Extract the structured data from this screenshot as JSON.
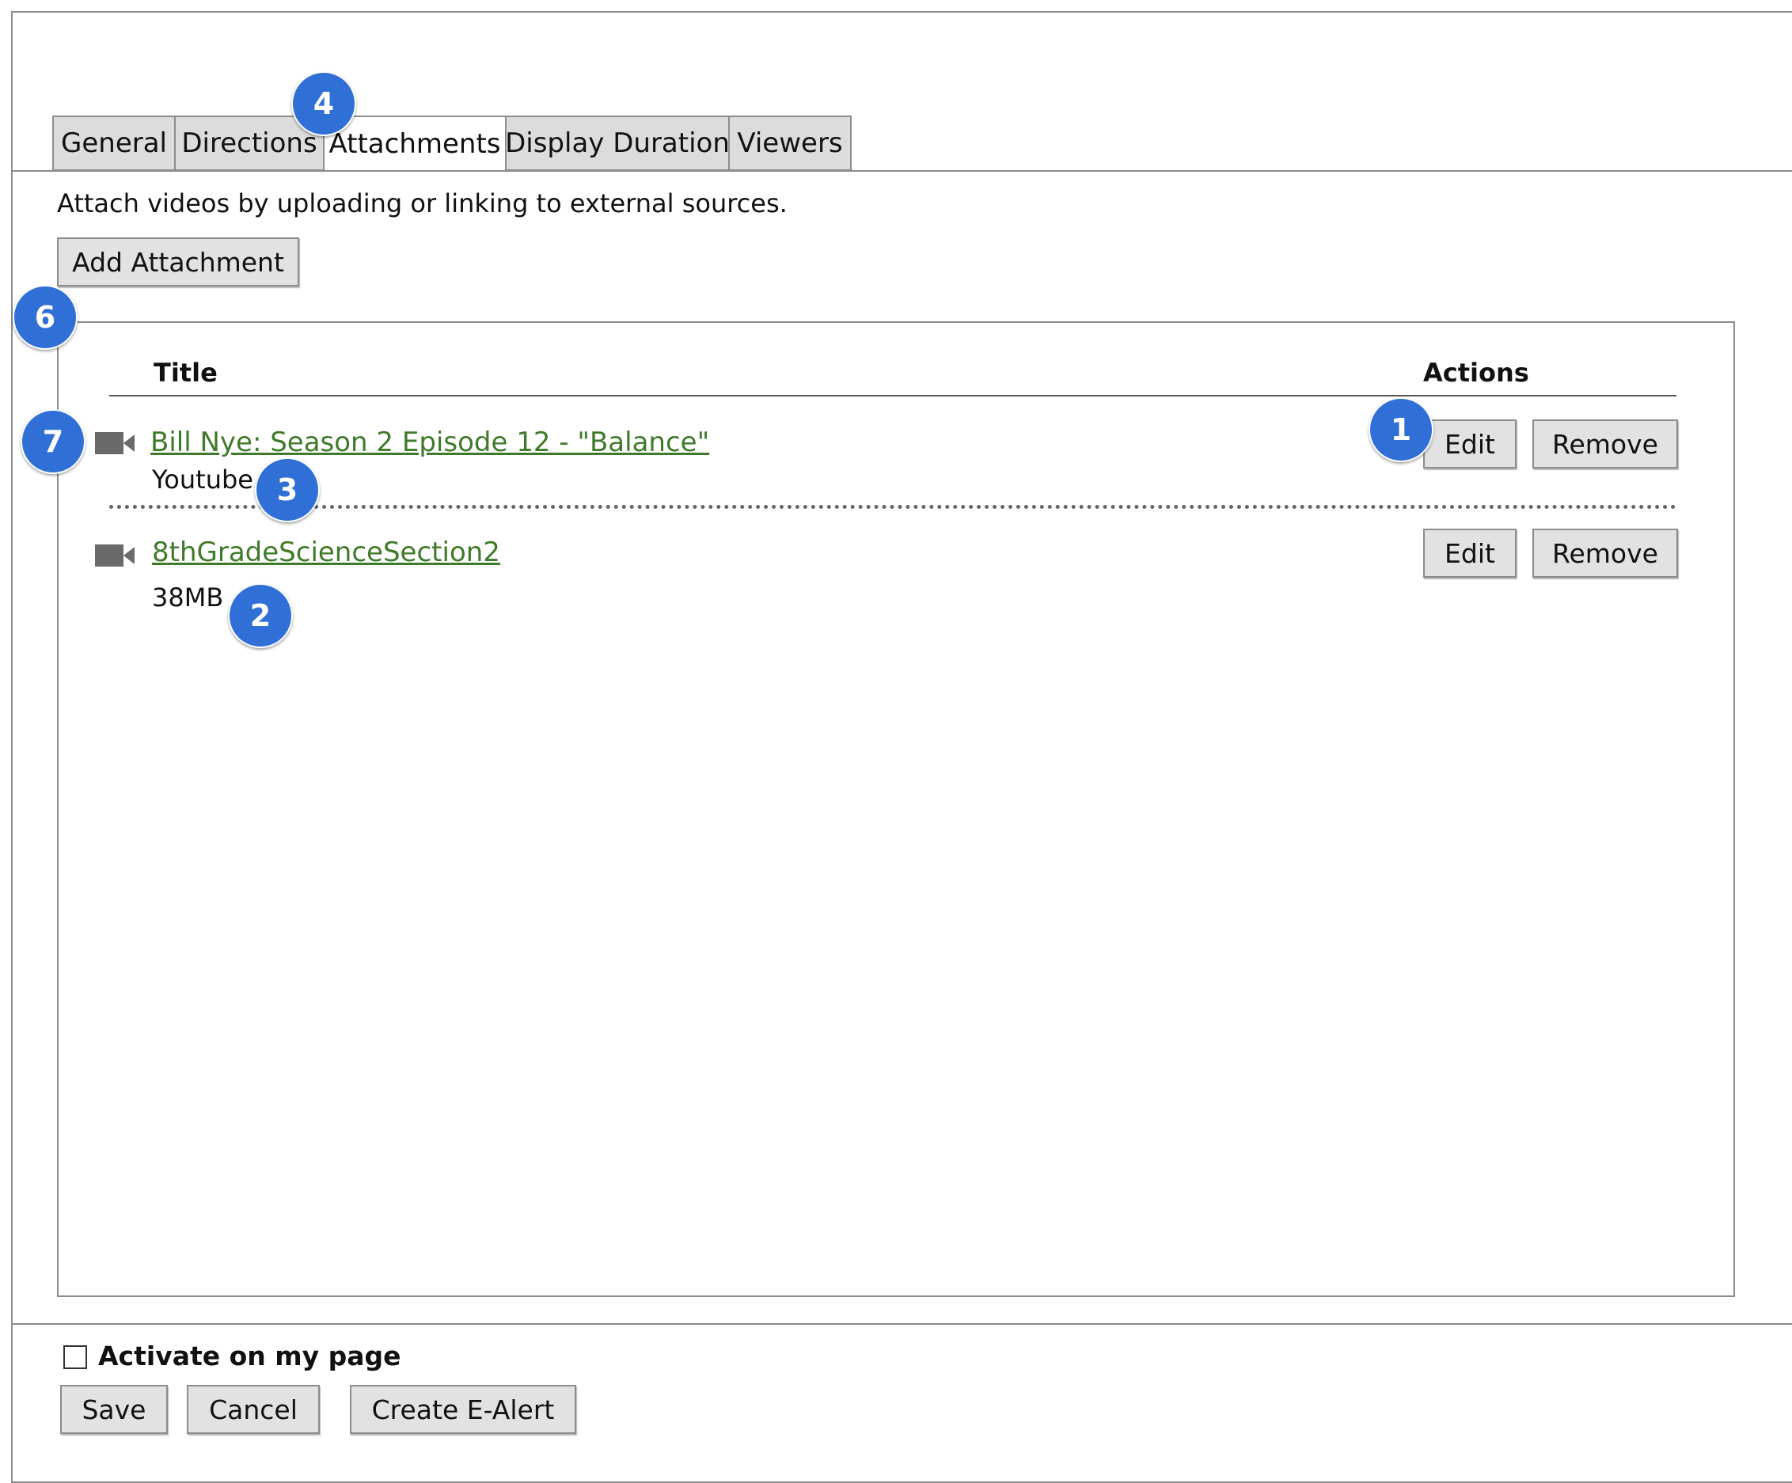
{
  "tabs": [
    {
      "label": "General"
    },
    {
      "label": "Directions"
    },
    {
      "label": "Attachments",
      "active": true
    },
    {
      "label": "Display Duration"
    },
    {
      "label": "Viewers"
    }
  ],
  "instruction": "Attach videos by uploading or linking to external sources.",
  "add_attachment_label": "Add Attachment",
  "table": {
    "col_title": "Title",
    "col_actions": "Actions"
  },
  "attachments": [
    {
      "title": "Bill Nye: Season 2 Episode 12 - \"Balance\"",
      "subtitle": "Youtube",
      "icon": "video-camera-icon",
      "edit_label": "Edit",
      "remove_label": "Remove"
    },
    {
      "title": "8thGradeScienceSection2",
      "subtitle": "38MB",
      "icon": "video-camera-icon",
      "edit_label": "Edit",
      "remove_label": "Remove"
    }
  ],
  "markers": [
    "4",
    "6",
    "7",
    "1",
    "3",
    "2"
  ],
  "footer": {
    "activate_label": "Activate on my page",
    "activate_checked": false,
    "save_label": "Save",
    "cancel_label": "Cancel",
    "ealert_label": "Create E-Alert"
  },
  "colors": {
    "marker": "#2f6fd6",
    "link": "#3f7a2a",
    "button": "#e2e2e2"
  }
}
